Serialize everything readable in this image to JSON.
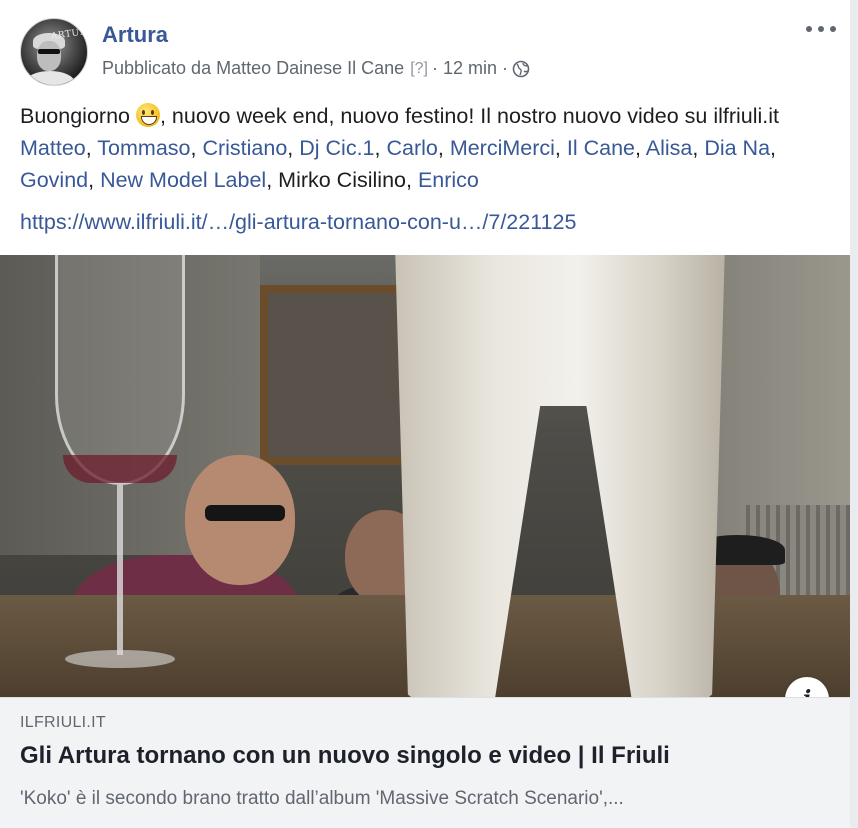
{
  "page": {
    "name": "Artura",
    "avatar_text": "ARTURA"
  },
  "meta": {
    "published_by": "Pubblicato da Matteo Dainese Il Cane",
    "help_mark": "[?]",
    "time": "12 min",
    "separator": "·",
    "audience_icon": "globe-icon"
  },
  "post": {
    "text_intro": "Buongiorno ",
    "emoji": "grinning-face",
    "text_after_emoji": ", nuovo week end, nuovo festino! Il nostro nuovo video su ilfriuli.it ",
    "tags": [
      "Matteo",
      "Tommaso",
      "Cristiano",
      "Dj Cic.1",
      "Carlo",
      "MerciMerci",
      "Il Cane",
      "Alisa",
      "Dia Na",
      "Govind",
      "New Model Label"
    ],
    "plain_name": "Mirko Cisilino",
    "last_tag": "Enrico",
    "comma": ", ",
    "url": "https://www.ilfriuli.it/…/gli-artura-tornano-con-u…/7/221125"
  },
  "preview": {
    "domain": "ILFRIULI.IT",
    "title": "Gli Artura tornano con un nuovo singolo e video | Il Friuli",
    "description": "'Koko' è il secondo brano tratto dall’album 'Massive Scratch Scenario',..."
  },
  "icons": {
    "more": "more-options-icon",
    "info": "info-icon",
    "info_glyph": "i"
  },
  "colors": {
    "link": "#385898",
    "text": "#1c1e21",
    "meta": "#606770",
    "preview_bg": "#f2f3f5"
  }
}
